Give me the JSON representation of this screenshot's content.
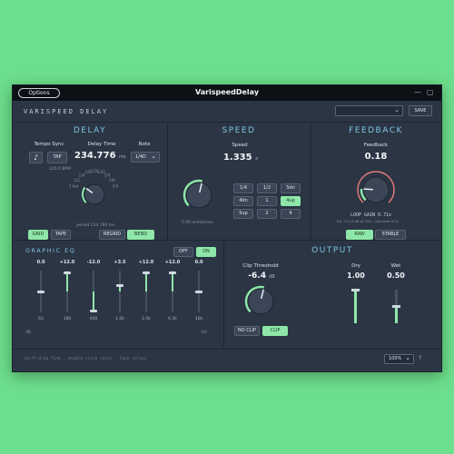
{
  "titlebar": {
    "options_label": "Options",
    "title": "VarispeedDelay",
    "minimize": "—",
    "maximize": "▢"
  },
  "header": {
    "title": "VARISPEED DELAY",
    "preset_value": "",
    "preset_caret": "⌄",
    "save_label": "SAVE"
  },
  "delay": {
    "title": "DELAY",
    "tempo_sync_label": "Tempo Sync",
    "note_icon": "♪",
    "tap_label": "TAP",
    "bpm": "120.0 BPM",
    "delay_time_label": "Delay Time",
    "delay_time_value": "234.776",
    "delay_time_unit": "ms",
    "note_label": "Note",
    "note_value": "1/4D",
    "note_caret": "⌄",
    "ticks": [
      "1 bar",
      "1/2",
      "1/4",
      "1/8",
      "1/16",
      "1/32",
      "3/4",
      "5/8",
      "2/4"
    ],
    "period_text": "period 234.780 ms",
    "mode_buttons": [
      {
        "label": "GRID",
        "on": true
      },
      {
        "label": "TAPE",
        "on": false
      }
    ],
    "regrid_label": "REGRID",
    "bend_label": "BEND",
    "knob_value": 0.3
  },
  "speed": {
    "title": "SPEED",
    "label": "Speed",
    "value": "1.335",
    "unit": "x",
    "semitones_text": "5.00 semitones",
    "knob_value": 0.55,
    "grid": [
      {
        "label": "1/4",
        "on": false
      },
      {
        "label": "1/2",
        "on": false
      },
      {
        "label": "5dn",
        "on": false
      },
      {
        "label": "4dn",
        "on": false
      },
      {
        "label": "1",
        "on": false
      },
      {
        "label": "4up",
        "on": true
      },
      {
        "label": "5up",
        "on": false
      },
      {
        "label": "2",
        "on": false
      },
      {
        "label": "4",
        "on": false
      }
    ]
  },
  "feedback": {
    "title": "FEEDBACK",
    "label": "Feedback",
    "value": "0.18",
    "loop_gain_text": "LOOP GAIN 0.71x",
    "info_text": "EQ +11.0 dB at 100 · info here 0.21",
    "knob_value": 0.18,
    "raw_label": "RAW",
    "stable_label": "STABLE"
  },
  "eq": {
    "title": "GRAPHIC EQ",
    "off_label": "OFF",
    "on_label": "ON",
    "db_label": "dB",
    "hz_label": "Hz",
    "bands": [
      {
        "value": "0.0",
        "freq": "63",
        "gain": 0.0
      },
      {
        "value": "+12.0",
        "freq": "160",
        "gain": 12.0
      },
      {
        "value": "-12.0",
        "freq": "400",
        "gain": -12.0
      },
      {
        "value": "+3.5",
        "freq": "1.0k",
        "gain": 3.5
      },
      {
        "value": "+12.0",
        "freq": "2.5k",
        "gain": 12.0
      },
      {
        "value": "+12.0",
        "freq": "6.3k",
        "gain": 12.0
      },
      {
        "value": "0.0",
        "freq": "16k",
        "gain": 0.0
      }
    ]
  },
  "output": {
    "title": "OUTPUT",
    "clip_label": "Clip Threshold",
    "clip_value": "-6.4",
    "clip_unit": "dB",
    "clip_knob_value": 0.55,
    "no_clip_label": "NO CLIP",
    "clip_btn_label": "CLIP",
    "dry_label": "Dry",
    "dry_value": "1.00",
    "dry_level": 1.0,
    "wet_label": "Wet",
    "wet_value": "0.50",
    "wet_level": 0.5
  },
  "footer": {
    "hint": "shift-drag fine  .  double-click reset  .  type values",
    "zoom": "100%",
    "zoom_caret": "⌄",
    "help": "?"
  },
  "colors": {
    "accent": "#8ee7a9",
    "section_title": "#7ec6e0",
    "window": "#2b3544",
    "titlebar": "#0d1116",
    "knob_ring": "#e07878"
  }
}
